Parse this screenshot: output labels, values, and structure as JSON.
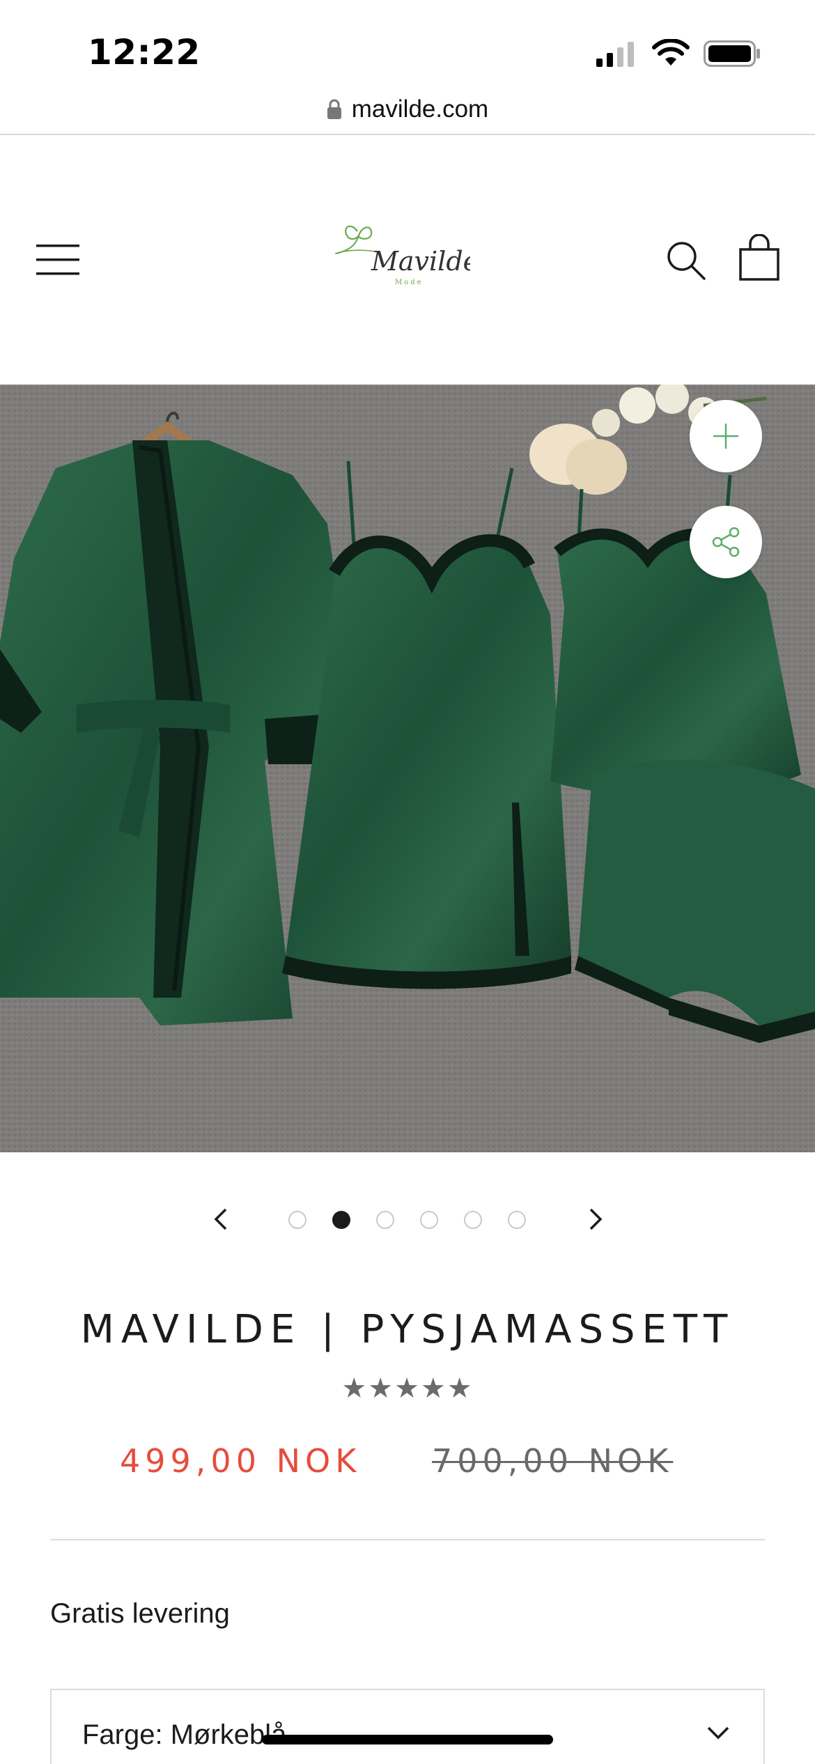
{
  "status_bar": {
    "time": "12:22"
  },
  "browser": {
    "url": "mavilde.com"
  },
  "header": {
    "logo_text": "Mavilde",
    "logo_subtext": "Mode"
  },
  "product": {
    "title": "MAVILDE | PYSJAMASSETT",
    "rating_stars": "★★★★★",
    "rating_value": 5,
    "price_sale": "499,00 NOK",
    "price_compare": "700,00 NOK",
    "delivery_text": "Gratis levering",
    "variant_label": "Farge: Mørkeblå",
    "image_icon": "green-satin-pajama-set-image"
  },
  "carousel": {
    "total_slides": 6,
    "active_index": 1
  },
  "colors": {
    "accent_sale": "#e74c3c",
    "text_primary": "#1c1b1b",
    "logo_green": "#6aa84f",
    "button_green": "#5cae6c"
  }
}
